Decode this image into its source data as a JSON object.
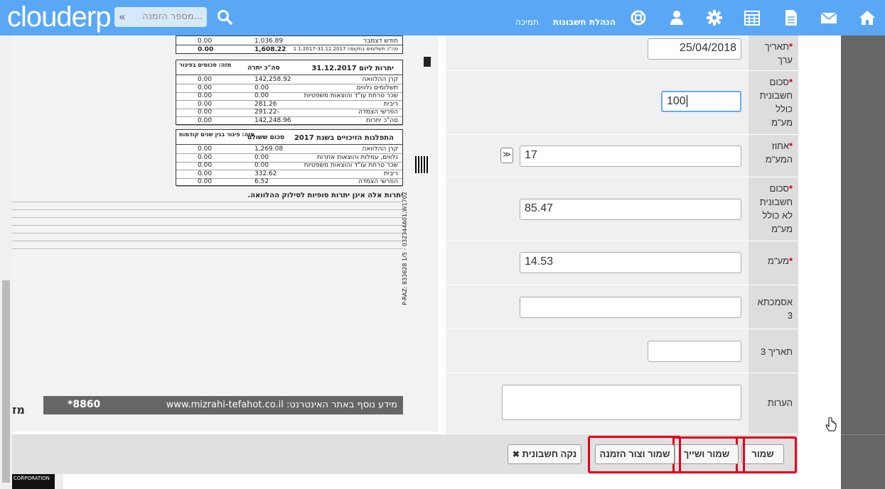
{
  "header": {
    "logo": "clouderp",
    "search_placeholder": "מספר הזמנה...",
    "nav_support": "תמיכה",
    "nav_accounts": "הנהלת חשבונות"
  },
  "document": {
    "rows_top": [
      {
        "label": "חודש דצמבר",
        "v1": "1,036.89",
        "v2": "0.00"
      },
      {
        "label": "סה\"כ תשלומים בתקופה 1.1.2017-31.12.2017",
        "v1": "1,608.22",
        "v2": "0.00"
      }
    ],
    "table1_title": "יתרות ליום 31.12.2017",
    "table1_col1": "סה\"כ יתרה",
    "table1_col2": "מזה: סכומים בפיגור",
    "table1_rows": [
      {
        "label": "קרן ההלוואה",
        "v1": "142,258.92",
        "v2": "0.00"
      },
      {
        "label": "תשלומים נלווים",
        "v1": "0.00",
        "v2": "0.00"
      },
      {
        "label": "שכר טרחת עו\"ד והוצאות משפטיות",
        "v1": "0.00",
        "v2": "0.00"
      },
      {
        "label": "ריבית",
        "v1": "281.26",
        "v2": "0.00"
      },
      {
        "label": "הפרשי הצמדה",
        "v1": "-291.22",
        "v2": "0.00"
      },
      {
        "label": "סה\"כ יתרות",
        "v1": "142,248.96",
        "v2": "0.00"
      }
    ],
    "table2_title": "התפלגות הזיכויים בשנת 2017",
    "table2_col1": "סכום ששולם",
    "table2_col2": "מזה: פיגור בגין שנים קודמות",
    "table2_rows": [
      {
        "label": "קרן ההלוואה",
        "v1": "1,269.08",
        "v2": "0.00"
      },
      {
        "label": "נלווים, עמלות והוצאות אחרות",
        "v1": "0.00",
        "v2": "0.00"
      },
      {
        "label": "שכר טרחת עו\"ד והוצאות משפטיות",
        "v1": "0.00",
        "v2": "0.00"
      },
      {
        "label": "ריבית",
        "v1": "332.62",
        "v2": "0.00"
      },
      {
        "label": "הפרשי הצמדה",
        "v1": "6.52",
        "v2": "0.00"
      }
    ],
    "note_heading": "יתרות אלה אינן יתרות סופיות לסילוק ההלוואה.",
    "banner_text": "מידע נוסף באתר האינטרנט: www.mizrahi-tefahot.co.il",
    "banner_phone": "*8860",
    "side_code": "P-RAZ: 833628   1/5 - 032344A01,W1702",
    "corner": "CORPORATION"
  },
  "form": {
    "fields": [
      {
        "label": "תאריך ערך",
        "required": true,
        "value": "25/04/2018"
      },
      {
        "label": "סכום חשבונית כולל מע\"מ",
        "required": true,
        "value": "100"
      },
      {
        "label": "אחוז המע\"מ",
        "required": true,
        "value": "17",
        "dropdown": "≫"
      },
      {
        "label": "סכום חשבונית לא כולל מע\"מ",
        "required": true,
        "value": "85.47"
      },
      {
        "label": "מע\"מ",
        "required": true,
        "value": "14.53"
      },
      {
        "label": "אסמכתא 3",
        "required": false,
        "value": ""
      },
      {
        "label": "תאריך 3",
        "required": false,
        "value": ""
      },
      {
        "label": "הערות",
        "required": false,
        "value": ""
      }
    ],
    "required_mark": "*"
  },
  "buttons": {
    "save": "שמור",
    "save_assign": "שמור ושייך",
    "save_create_order": "שמור וצור הזמנה",
    "clear_invoice": "נקה חשבונית",
    "clear_icon": "✖"
  },
  "colors": {
    "topbar": "#5aa8f5",
    "highlight": "#e3001b"
  }
}
